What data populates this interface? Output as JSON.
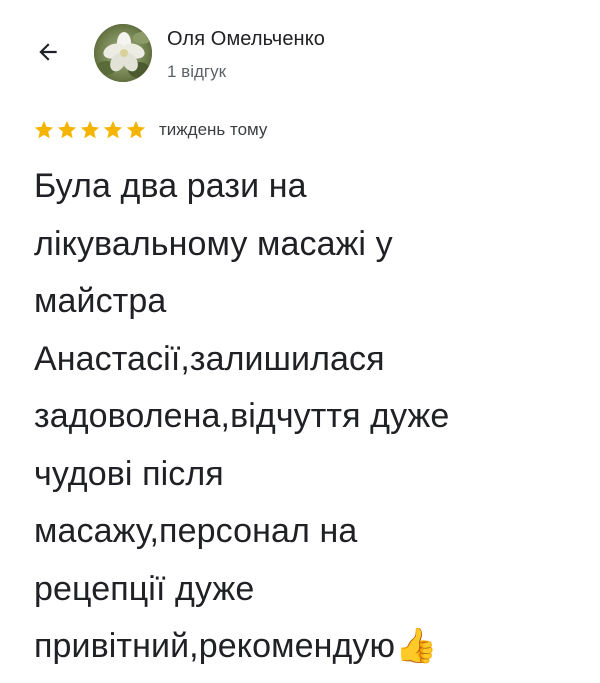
{
  "header": {
    "back_icon": "arrow-left-icon",
    "author_name": "Оля Омельченко",
    "review_count": "1 відгук",
    "avatar_icon": "flower-avatar-icon"
  },
  "review": {
    "rating": 5,
    "rating_max": 5,
    "star_color": "#f4b400",
    "time": "тиждень тому",
    "text": "Була два рази на\nлікувальному масажі у\nмайстра\nАнастасії,залишилася\nзадоволена,відчуття дуже\nчудові після\nмасажу,персонал на\nрецепції дуже\nпривітний,рекомендую👍"
  }
}
